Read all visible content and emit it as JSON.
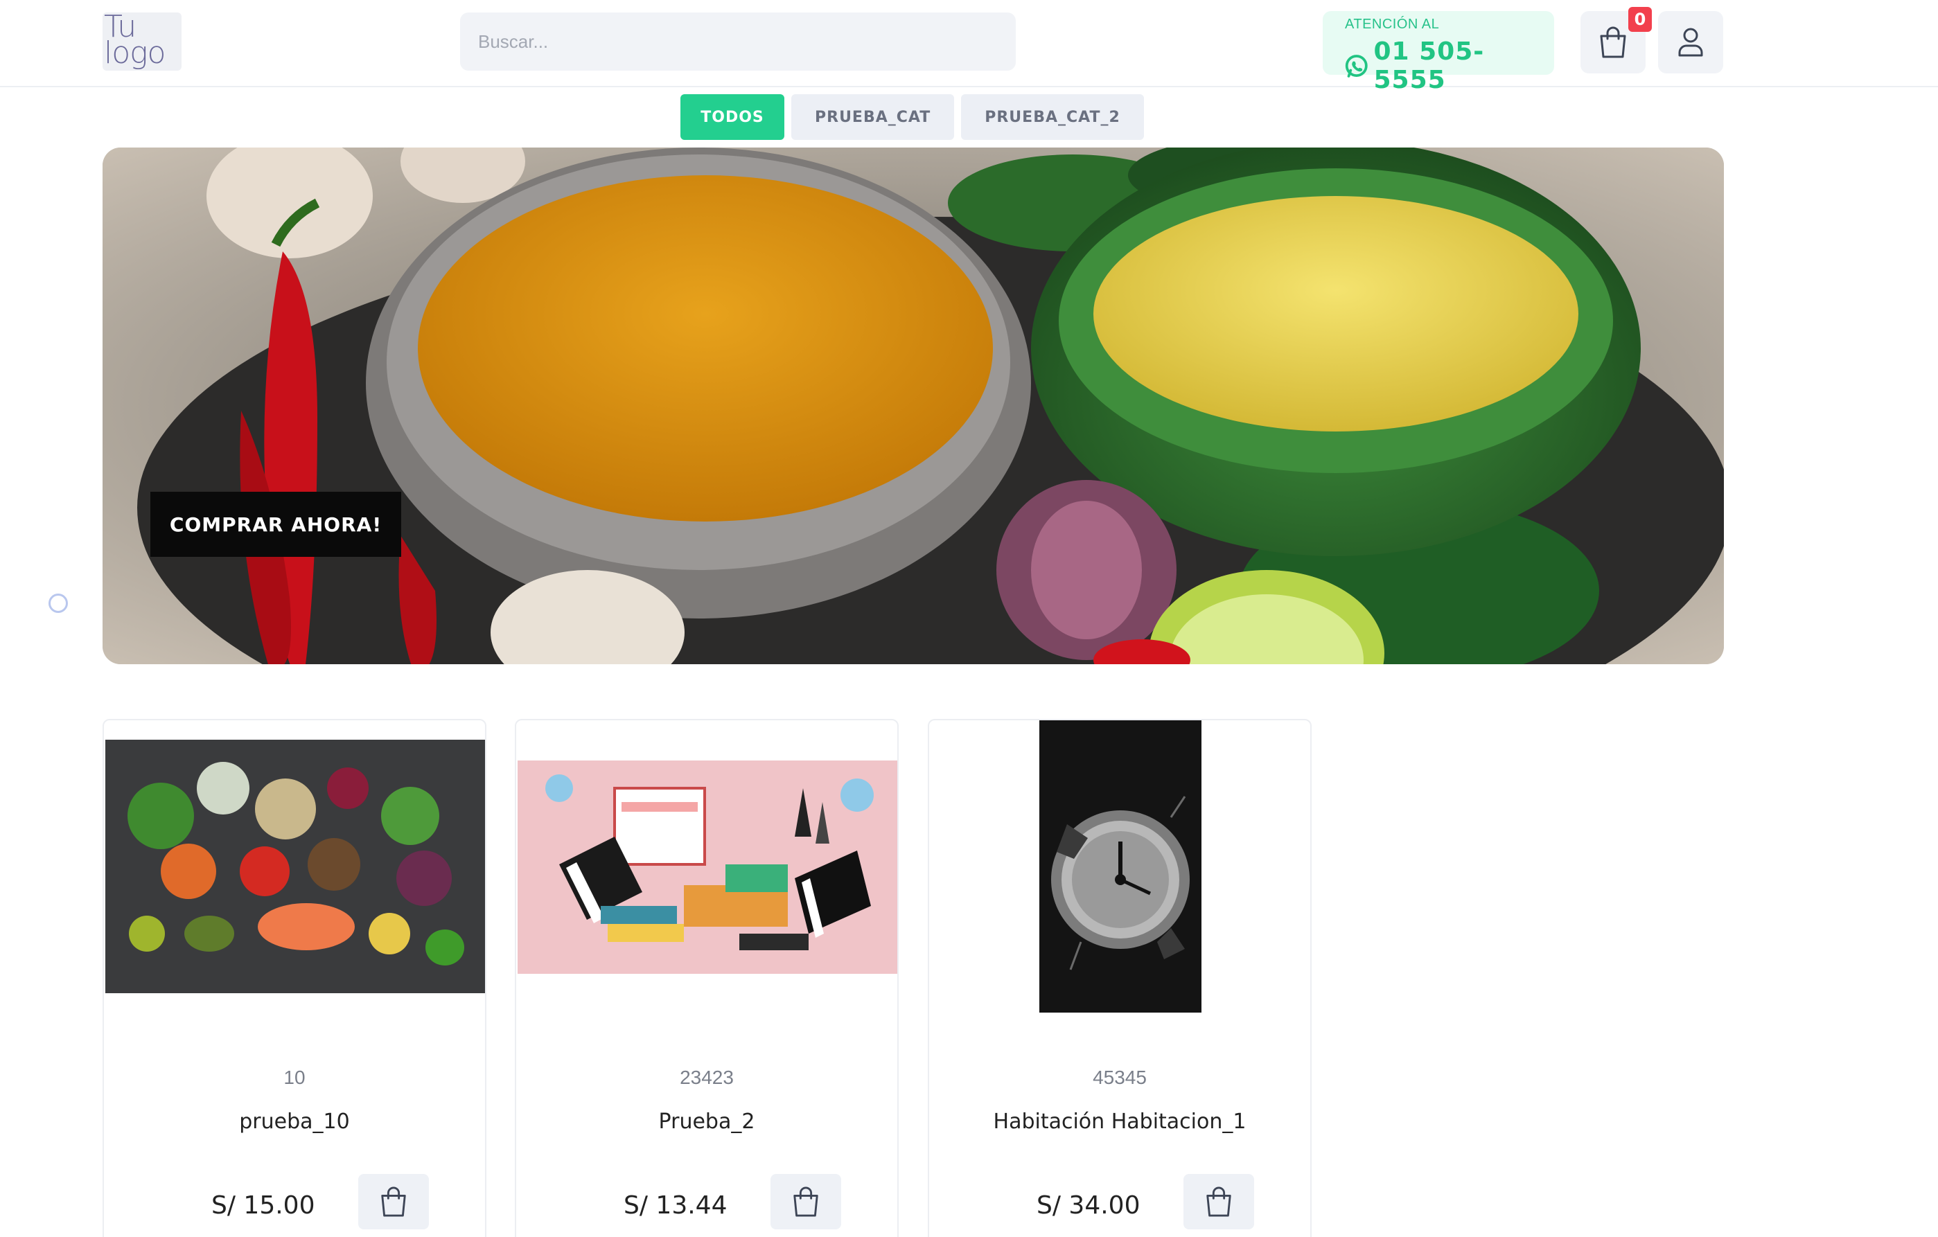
{
  "header": {
    "logo_line1": "Tu",
    "logo_line2": "logo",
    "search_placeholder": "Buscar...",
    "contact_label": "ATENCIÓN AL",
    "contact_phone": "01 505-5555",
    "cart_count": "0",
    "icons": {
      "whatsapp": "whatsapp-icon",
      "cart": "shopping-bag-icon",
      "user": "user-icon"
    }
  },
  "categories": [
    {
      "label": "TODOS",
      "active": true
    },
    {
      "label": "PRUEBA_CAT",
      "active": false
    },
    {
      "label": "PRUEBA_CAT_2",
      "active": false
    }
  ],
  "hero": {
    "cta_label": "COMPRAR AHORA!",
    "slides": 2,
    "active_slide": 2
  },
  "products": [
    {
      "code": "10",
      "name": "prueba_10",
      "price": "S/ 15.00"
    },
    {
      "code": "23423",
      "name": "Prueba_2",
      "price": "S/ 13.44"
    },
    {
      "code": "45345",
      "name": "Habitación Habitacion_1",
      "price": "S/ 34.00"
    }
  ],
  "colors": {
    "accent_green": "#23cf8f",
    "badge_red": "#f2404d",
    "cta_black": "#0a0a0a"
  }
}
